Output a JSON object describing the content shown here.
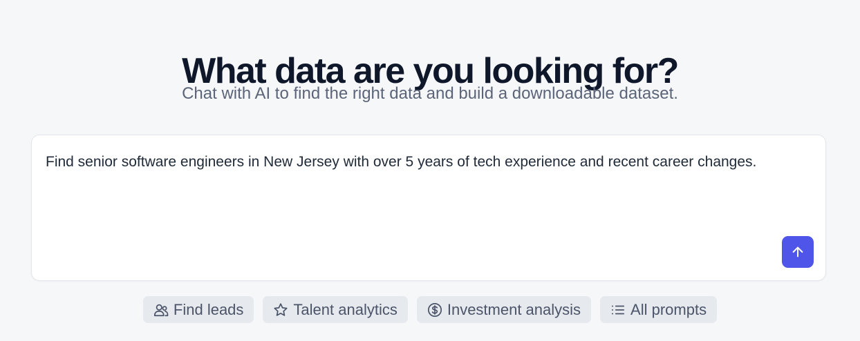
{
  "header": {
    "title": "What data are you looking for?",
    "subtitle": "Chat with AI to find the right data and build a downloadable dataset."
  },
  "prompt": {
    "value": "Find senior software engineers in New Jersey with over 5 years of tech experience and recent career changes.",
    "send_icon": "arrow-up-icon"
  },
  "suggestions": [
    {
      "label": "Find leads",
      "icon": "users-icon"
    },
    {
      "label": "Talent analytics",
      "icon": "star-icon"
    },
    {
      "label": "Investment analysis",
      "icon": "dollar-circle-icon"
    },
    {
      "label": "All prompts",
      "icon": "list-icon"
    }
  ],
  "colors": {
    "background": "#f6f7f9",
    "accent": "#4f55e8",
    "chip_background": "#e6e9ee",
    "heading": "#0f172a"
  }
}
